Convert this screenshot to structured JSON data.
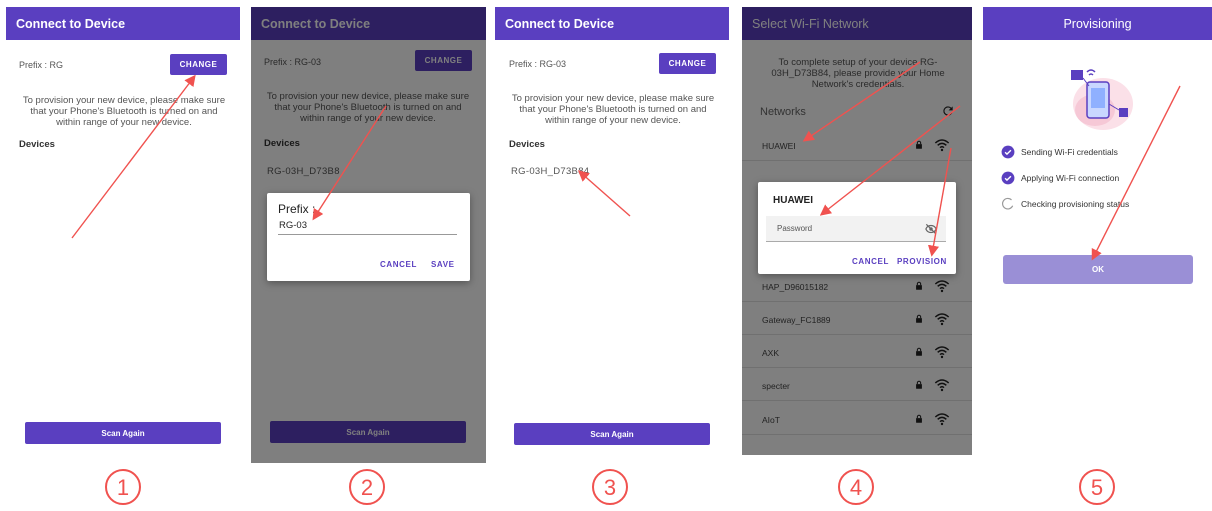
{
  "colors": {
    "primary": "#5a3fc0",
    "arrow": "#f0524f",
    "circle_number": "#f0524f",
    "ok_button": "#9a8fd6"
  },
  "screen1": {
    "title": "Connect to Device",
    "prefix_label": "Prefix : RG",
    "change_label": "CHANGE",
    "instructions": "To provision your new device, please make sure that your Phone's Bluetooth is turned on and within range of your new device.",
    "devices_heading": "Devices",
    "scan_again_label": "Scan Again",
    "step_number": "1"
  },
  "screen2": {
    "title": "Connect to Device",
    "prefix_label": "Prefix : RG-03",
    "change_label": "CHANGE",
    "instructions": "To provision your new device, please make sure that your Phone's Bluetooth is turned on and within range of your new device.",
    "devices_heading": "Devices",
    "device_item": "RG-03H_D73B8",
    "scan_again_label": "Scan Again",
    "dialog": {
      "title": "Prefix :",
      "input_value": "RG-03",
      "cancel_label": "CANCEL",
      "save_label": "SAVE"
    },
    "step_number": "2"
  },
  "screen3": {
    "title": "Connect to Device",
    "prefix_label": "Prefix : RG-03",
    "change_label": "CHANGE",
    "instructions": "To provision your new device, please make sure that your Phone's Bluetooth is turned on and within range of your new device.",
    "devices_heading": "Devices",
    "device_item": "RG-03H_D73B84",
    "scan_again_label": "Scan Again",
    "step_number": "3"
  },
  "screen4": {
    "title": "Select Wi-Fi Network",
    "instructions": "To complete setup of your device RG-03H_D73B84, please provide your Home Network's credentials.",
    "networks_label": "Networks",
    "networks": [
      {
        "name": "HUAWEI"
      },
      {
        "name": "HAP_D96015182"
      },
      {
        "name": "Gateway_FC1889"
      },
      {
        "name": "AXK"
      },
      {
        "name": "specter"
      },
      {
        "name": "AIoT"
      }
    ],
    "dialog": {
      "title": "HUAWEI",
      "password_placeholder": "Password",
      "cancel_label": "CANCEL",
      "provision_label": "PROVISION"
    },
    "step_number": "4"
  },
  "screen5": {
    "title": "Provisioning",
    "steps": [
      {
        "label": "Sending Wi-Fi credentials",
        "done": true
      },
      {
        "label": "Applying Wi-Fi connection",
        "done": true
      },
      {
        "label": "Checking provisioning status",
        "done": false
      }
    ],
    "ok_label": "OK",
    "step_number": "5"
  }
}
